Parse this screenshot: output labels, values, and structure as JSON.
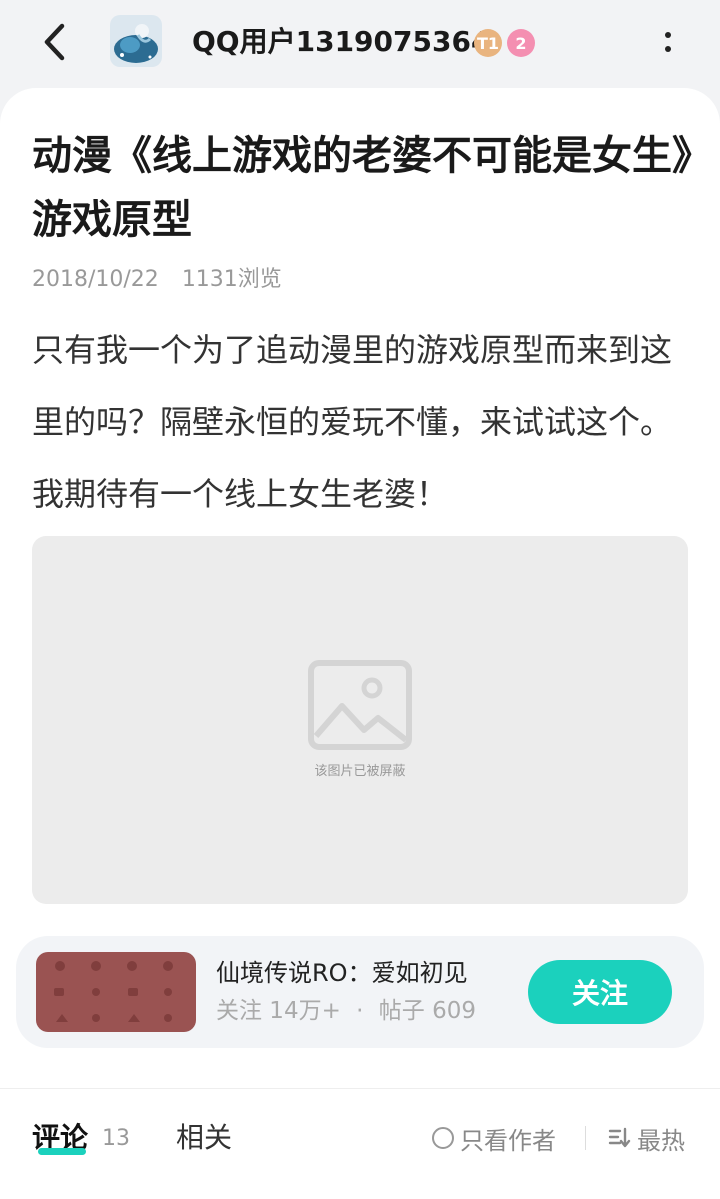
{
  "header": {
    "username": "QQ用户1319075364",
    "level_badge": "T1",
    "badge_count": "2",
    "back_icon": "chevron-left-icon",
    "more_icon": "vertical-dots-icon"
  },
  "post": {
    "title": "动漫《线上游戏的老婆不可能是女生》游戏原型",
    "date": "2018/10/22",
    "views": "1131浏览",
    "body": "只有我一个为了追动漫里的游戏原型而来到这里的吗？隔壁永恒的爱玩不懂，来试试这个。我期待有一个线上女生老婆！",
    "image_caption": "该图片已被屏蔽"
  },
  "game": {
    "name": "仙境传说RO：爱如初见",
    "followers": "关注 14万+",
    "separator": "·",
    "posts": "帖子 609",
    "follow_label": "关注",
    "thumb_color": "#9a5352"
  },
  "tabs": {
    "comments_label": "评论",
    "comments_count": "13",
    "related_label": "相关",
    "author_only_label": "只看作者",
    "sort_label": "最热"
  },
  "colors": {
    "accent": "#1bd1bd",
    "background": "#f2f3f5"
  }
}
